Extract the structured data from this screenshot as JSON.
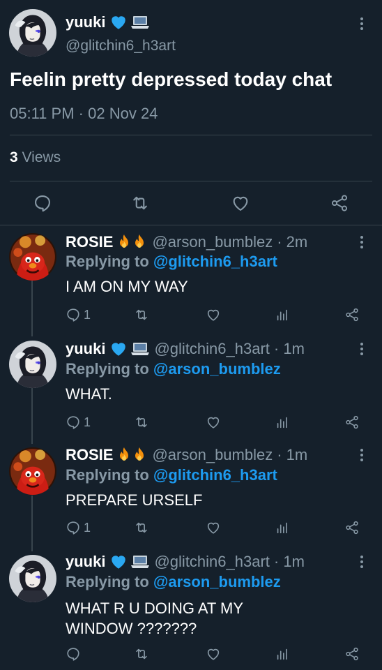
{
  "main_tweet": {
    "display_name": "yuuki",
    "handle": "@glitchin6_h3art",
    "text": "Feelin pretty depressed today chat",
    "time": "05:11 PM",
    "separator": "·",
    "date": "02 Nov 24",
    "views_count": "3",
    "views_label": "Views"
  },
  "replies": [
    {
      "display_name": "ROSIE",
      "emoji": "🔥🔥",
      "handle": "@arson_bumblez",
      "time": "· 2m",
      "replying_label": "Replying to",
      "replying_to": "@glitchin6_h3art",
      "text": "I AM ON MY WAY",
      "reply_count": "1"
    },
    {
      "display_name": "yuuki",
      "handle": "@glitchin6_h3art",
      "time": "· 1m",
      "replying_label": "Replying to",
      "replying_to": "@arson_bumblez",
      "text": "WHAT.",
      "reply_count": "1"
    },
    {
      "display_name": "ROSIE",
      "emoji": "🔥🔥",
      "handle": "@arson_bumblez",
      "time": "· 1m",
      "replying_label": "Replying to",
      "replying_to": "@glitchin6_h3art",
      "text": "PREPARE URSELF",
      "reply_count": "1"
    },
    {
      "display_name": "yuuki",
      "handle": "@glitchin6_h3art",
      "time": "· 1m",
      "replying_label": "Replying to",
      "replying_to": "@arson_bumblez",
      "text_line1": "WHAT R U DOING AT MY",
      "text_line2": "WINDOW ???????",
      "reply_count": ""
    }
  ],
  "colors": {
    "background": "#15202b",
    "muted": "#8899a6",
    "link": "#1d9bf0",
    "divider": "#38444d"
  },
  "icons": [
    "heart-emoji-blue",
    "laptop-emoji",
    "fire-emoji",
    "reply-icon",
    "retweet-icon",
    "like-icon",
    "views-icon",
    "share-icon",
    "more-icon"
  ]
}
